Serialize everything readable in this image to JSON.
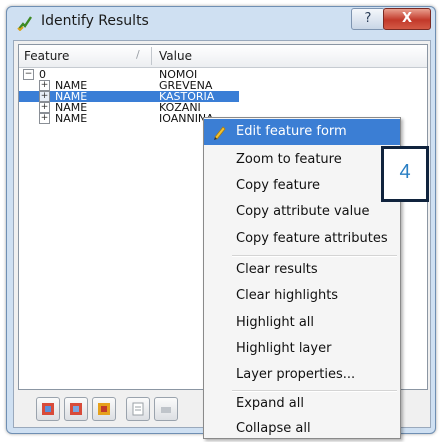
{
  "window": {
    "title": "Identify Results",
    "help_label": "?",
    "close_label": "X"
  },
  "tree": {
    "headers": {
      "feature": "Feature",
      "value": "Value",
      "sort_glyph": "/"
    },
    "rows": [
      {
        "expander": "−",
        "feature": "0",
        "value": "NOMOI"
      },
      {
        "expander": "+",
        "feature": "NAME",
        "value": "GREVENA"
      },
      {
        "expander": "+",
        "feature": "NAME",
        "value": "KASTORIA"
      },
      {
        "expander": "+",
        "feature": "NAME",
        "value": "KOZANI"
      },
      {
        "expander": "+",
        "feature": "NAME",
        "value": "IOANNINA"
      }
    ]
  },
  "context_menu": {
    "items": [
      {
        "label": "Edit feature form",
        "icon": "pencil-icon",
        "active": true
      },
      {
        "label": "Zoom to feature"
      },
      {
        "label": "Copy feature"
      },
      {
        "label": "Copy attribute value"
      },
      {
        "label": "Copy feature attributes"
      },
      {
        "label": "Clear results"
      },
      {
        "label": "Clear highlights"
      },
      {
        "label": "Highlight all"
      },
      {
        "label": "Highlight layer"
      },
      {
        "label": "Layer properties..."
      },
      {
        "label": "Expand all"
      },
      {
        "label": "Collapse all"
      }
    ]
  },
  "callout": {
    "text": "4"
  },
  "colors": {
    "selection": "#3a7ed6",
    "menu_highlight": "#3b7ed4",
    "close_button": "#c2392a",
    "callout_text": "#2a7fc4"
  },
  "toolbar": {
    "icons": [
      "expand-tree-icon",
      "collapse-tree-icon",
      "expand-new-icon",
      "open-form-icon",
      "print-icon"
    ]
  }
}
